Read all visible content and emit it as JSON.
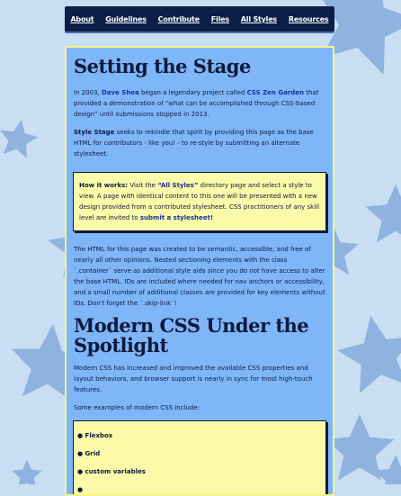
{
  "nav": {
    "items": [
      "About",
      "Guidelines",
      "Contribute",
      "Files",
      "All Styles",
      "Resources"
    ]
  },
  "section1": {
    "title": "Setting the Stage",
    "p1_before": "In 2003, ",
    "p1_link1": "Dave Shea",
    "p1_mid": " began a legendary project called ",
    "p1_link2": "CSS Zen Garden",
    "p1_after": " that provided a demonstration of “what can be accomplished through CSS-based design” until submissions stopped in 2013.",
    "p2_strong": "Style Stage",
    "p2_after": " seeks to rekindle that spirit by providing this page as the base HTML for contributors - like you! - to re-style by submitting an alternate stylesheet.",
    "callout_strong": "How it works:",
    "callout_before": " Visit the ",
    "callout_link1": "“All Styles”",
    "callout_mid": " directory page and select a style to view. A page with identical content to this one will be presented with a new design provided from a contributed stylesheet. CSS practitioners of any skill level are invited to ",
    "callout_link2": "submit a stylesheet!",
    "p3": "The HTML for this page was created to be semantic, accessible, and free of nearly all other opinions. Nested sectioning elements with the class `.container` serve as additional style aids since you do not have access to alter the base HTML. IDs are included where needed for nav anchors or accessibility, and a small number of additional classes are provided for key elements without IDs. Don't forget the `.skip-link`!"
  },
  "section2": {
    "title": "Modern CSS Under the Spotlight",
    "p1": "Modern CSS has increased and improved the available CSS properties and layout behaviors, and browser support is nearly in sync for most high-touch features.",
    "p2": "Some examples of modern CSS include:",
    "list": [
      "● Flexbox",
      "● Grid",
      "● custom variables",
      "●"
    ]
  },
  "colors": {
    "background": "#c9ddf3",
    "stars": "#8fb3de",
    "nav": "#0d1e47",
    "container": "#7eb6f8",
    "callout": "#fbfaa8",
    "text": "#0e1a3d",
    "link": "#1a2fa0"
  }
}
